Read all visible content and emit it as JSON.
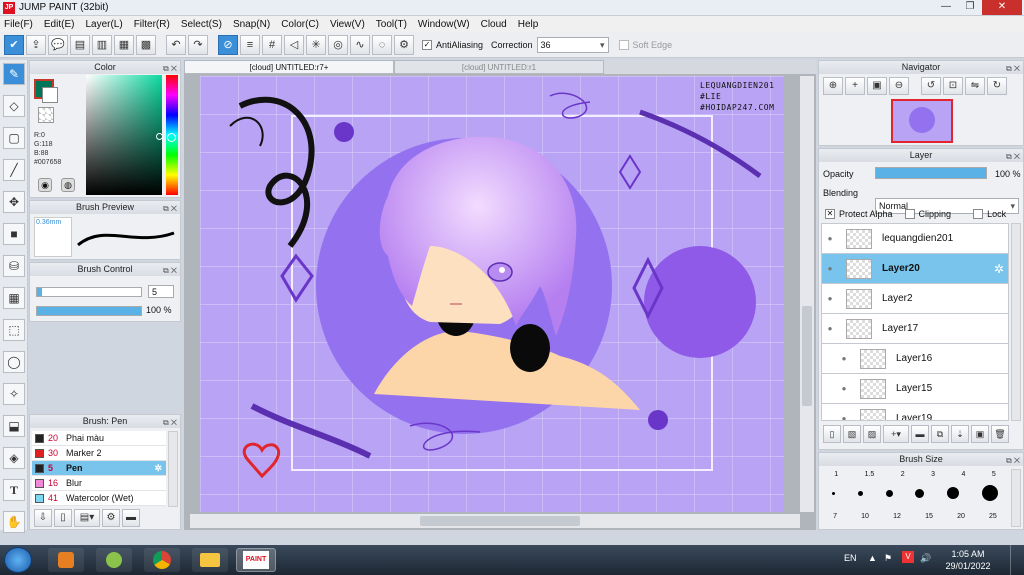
{
  "window": {
    "title": "JUMP PAINT (32bit)",
    "logo_text": "JP"
  },
  "menu": [
    "File(F)",
    "Edit(E)",
    "Layer(L)",
    "Filter(R)",
    "Select(S)",
    "Snap(N)",
    "Color(C)",
    "View(V)",
    "Tool(T)",
    "Window(W)",
    "Cloud",
    "Help"
  ],
  "toolbar": {
    "antialiasing_label": "AntiAliasing",
    "correction_label": "Correction",
    "correction_value": "36",
    "soft_edge_label": "Soft Edge"
  },
  "color_panel": {
    "title": "Color",
    "r": "R:0",
    "g": "G:118",
    "b": "B:88",
    "hex": "#007658",
    "current_color": "#007658"
  },
  "brush_preview": {
    "title": "Brush Preview",
    "size": "0.36mm"
  },
  "brush_control": {
    "title": "Brush Control",
    "size_value": "5",
    "opacity_value": "100 %",
    "size_fraction": 0.05,
    "opacity_fraction": 1.0
  },
  "brush_list": {
    "title": "Brush: Pen",
    "items": [
      {
        "size": "20",
        "name": "Phai màu",
        "swatch": "#222222"
      },
      {
        "size": "30",
        "name": "Marker 2",
        "swatch": "#e02020"
      },
      {
        "size": "5",
        "name": "Pen",
        "swatch": "#222222"
      },
      {
        "size": "16",
        "name": "Blur",
        "swatch": "#f08ad8"
      },
      {
        "size": "41",
        "name": "Watercolor (Wet)",
        "swatch": "#7dd7f0"
      }
    ]
  },
  "tabs": [
    "[cloud] UNTITLED:r7+",
    "[cloud] UNTITLED:r1"
  ],
  "artwork": {
    "watermark_lines": [
      "LEQUANGDIEN201",
      "#LIE",
      "#HOIDAP247.COM"
    ]
  },
  "navigator": {
    "title": "Navigator"
  },
  "layer_panel": {
    "title": "Layer",
    "opacity_label": "Opacity",
    "opacity_value": "100 %",
    "opacity_fraction": 1.0,
    "blending_label": "Blending",
    "blending_value": "Normal",
    "protect_alpha_label": "Protect Alpha",
    "clipping_label": "Clipping",
    "lock_label": "Lock",
    "layers": [
      "lequangdien201",
      "Layer20",
      "Layer2",
      "Layer17",
      "Layer16",
      "Layer15",
      "Layer19"
    ]
  },
  "brush_size": {
    "title": "Brush Size",
    "sizes_row1": [
      "1",
      "1.5",
      "2",
      "3",
      "4",
      "5"
    ],
    "sizes_row2": [
      "7",
      "10",
      "12",
      "15",
      "20",
      "25"
    ]
  },
  "taskbar": {
    "lang": "EN",
    "time": "1:05 AM",
    "date": "29/01/2022",
    "paint_label": "PAINT"
  }
}
